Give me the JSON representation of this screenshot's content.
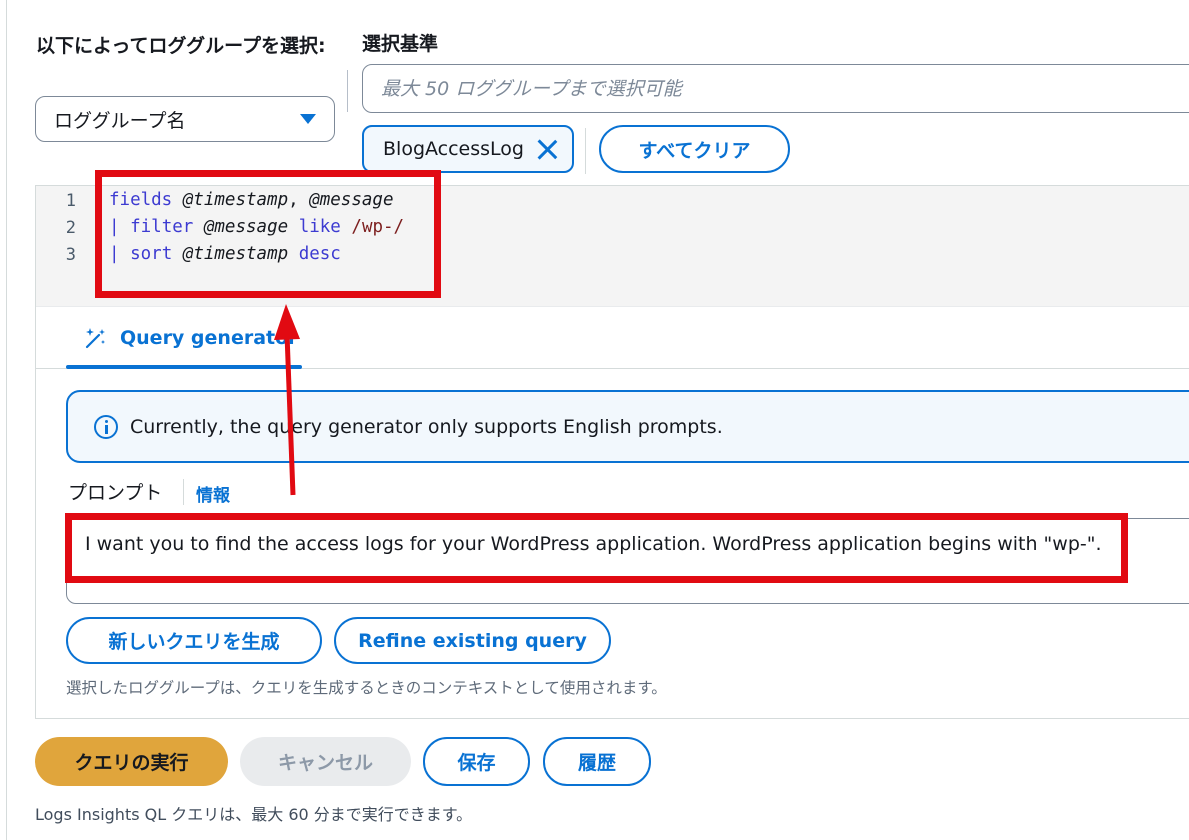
{
  "selector": {
    "label": "以下によってロググループを選択:",
    "dropdown_value": "ロググループ名"
  },
  "criteria": {
    "label": "選択基準",
    "search_placeholder": "最大 50 ロググループまで選択可能",
    "token_label": "BlogAccessLog",
    "clear_all_label": "すべてクリア"
  },
  "editor": {
    "line_numbers": [
      "1",
      "2",
      "3"
    ],
    "lines": [
      [
        {
          "t": "fields",
          "c": "kw"
        },
        {
          "t": " ",
          "c": ""
        },
        {
          "t": "@timestamp",
          "c": "at"
        },
        {
          "t": ", ",
          "c": ""
        },
        {
          "t": "@message",
          "c": "at"
        }
      ],
      [
        {
          "t": "|",
          "c": "pipe"
        },
        {
          "t": " ",
          "c": ""
        },
        {
          "t": "filter",
          "c": "kw"
        },
        {
          "t": " ",
          "c": ""
        },
        {
          "t": "@message",
          "c": "at"
        },
        {
          "t": " ",
          "c": ""
        },
        {
          "t": "like",
          "c": "kw"
        },
        {
          "t": " ",
          "c": ""
        },
        {
          "t": "/wp-/",
          "c": "re"
        }
      ],
      [
        {
          "t": "|",
          "c": "pipe"
        },
        {
          "t": " ",
          "c": ""
        },
        {
          "t": "sort",
          "c": "kw"
        },
        {
          "t": " ",
          "c": ""
        },
        {
          "t": "@timestamp",
          "c": "at"
        },
        {
          "t": " ",
          "c": ""
        },
        {
          "t": "desc",
          "c": "kw"
        }
      ]
    ]
  },
  "tabs": {
    "active_label": "Query generator"
  },
  "alert": {
    "text": "Currently, the query generator only supports English prompts."
  },
  "prompt": {
    "label": "プロンプト",
    "info_link": "情報",
    "value": "I want you to find the access logs for your WordPress application. WordPress application begins with \"wp-\"."
  },
  "generator_buttons": {
    "new_query": "新しいクエリを生成",
    "refine": "Refine existing query"
  },
  "hint": "選択したロググループは、クエリを生成するときのコンテキストとして使用されます。",
  "actions": {
    "run": "クエリの実行",
    "cancel": "キャンセル",
    "save": "保存",
    "history": "履歴"
  },
  "footer_note": "Logs Insights QL クエリは、最大 60 分まで実行できます。",
  "colors": {
    "accent": "#0972d3",
    "primary_button": "#e0a53c",
    "annotation_red": "#e10a12"
  }
}
